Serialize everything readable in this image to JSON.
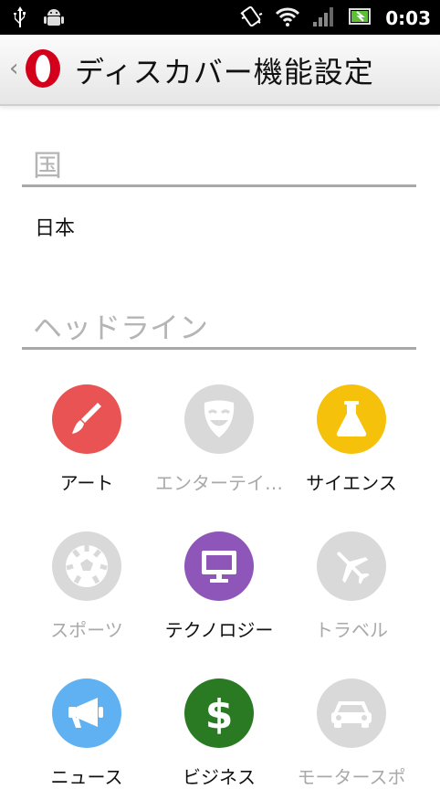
{
  "status_bar": {
    "time": "0:03",
    "icons": [
      "usb-icon",
      "android-debug-icon",
      "vibrate-icon",
      "wifi-icon",
      "signal-icon",
      "battery-icon"
    ]
  },
  "title_bar": {
    "title": "ディスカバー機能設定",
    "back_icon": "chevron-left-icon",
    "logo": "opera-logo"
  },
  "country_section": {
    "header": "国",
    "value": "日本"
  },
  "headline_section": {
    "header": "ヘッドライン",
    "categories": [
      {
        "label": "アート",
        "icon": "brush-icon",
        "enabled": true,
        "color": "#e95353"
      },
      {
        "label": "エンターテイ…",
        "icon": "mask-icon",
        "enabled": false,
        "color": "#d9d9d9"
      },
      {
        "label": "サイエンス",
        "icon": "flask-icon",
        "enabled": true,
        "color": "#f6c10a"
      },
      {
        "label": "スポーツ",
        "icon": "soccer-ball-icon",
        "enabled": false,
        "color": "#d9d9d9"
      },
      {
        "label": "テクノロジー",
        "icon": "monitor-icon",
        "enabled": true,
        "color": "#8e56b8"
      },
      {
        "label": "トラベル",
        "icon": "airplane-icon",
        "enabled": false,
        "color": "#d9d9d9"
      },
      {
        "label": "ニュース",
        "icon": "megaphone-icon",
        "enabled": true,
        "color": "#5fb1f2"
      },
      {
        "label": "ビジネス",
        "icon": "dollar-icon",
        "enabled": true,
        "color": "#2a7a23"
      },
      {
        "label": "モータースポ",
        "icon": "car-icon",
        "enabled": false,
        "color": "#d9d9d9"
      }
    ]
  }
}
